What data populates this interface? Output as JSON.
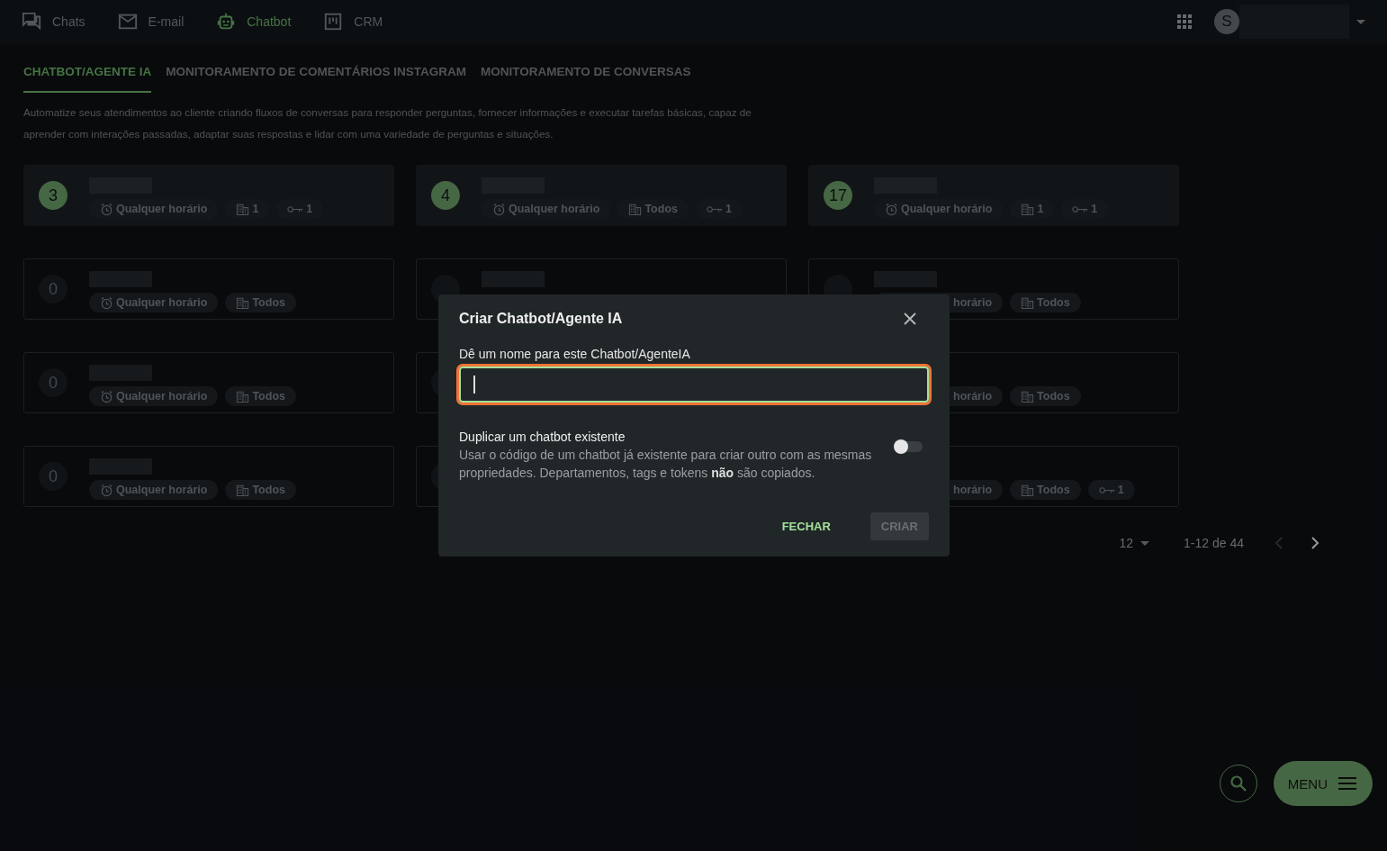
{
  "nav": {
    "items": [
      {
        "label": "Chats",
        "selected": false
      },
      {
        "label": "E-mail",
        "selected": false
      },
      {
        "label": "Chatbot",
        "selected": true
      },
      {
        "label": "CRM",
        "selected": false
      }
    ],
    "avatar": "S"
  },
  "tabs": [
    {
      "label": "CHATBOT/AGENTE IA",
      "selected": true
    },
    {
      "label": "MONITORAMENTO DE COMENTÁRIOS INSTAGRAM",
      "selected": false
    },
    {
      "label": "MONITORAMENTO DE CONVERSAS",
      "selected": false
    }
  ],
  "description": "Automatize seus atendimentos ao cliente criando fluxos de conversas para responder perguntas, fornecer informações e executar tarefas básicas, capaz de aprender com interações passadas, adaptar suas respostas e lidar com uma variedade de perguntas e situações.",
  "cards": [
    {
      "active": true,
      "count": "3",
      "chips": [
        {
          "kind": "time",
          "label": "Qualquer horário"
        },
        {
          "kind": "dept",
          "label": "1"
        },
        {
          "kind": "key",
          "label": "1"
        }
      ]
    },
    {
      "active": true,
      "count": "4",
      "chips": [
        {
          "kind": "time",
          "label": "Qualquer horário"
        },
        {
          "kind": "dept",
          "label": "Todos"
        },
        {
          "kind": "key",
          "label": "1"
        }
      ]
    },
    {
      "active": true,
      "count": "17",
      "chips": [
        {
          "kind": "time",
          "label": "Qualquer horário"
        },
        {
          "kind": "dept",
          "label": "1"
        },
        {
          "kind": "key",
          "label": "1"
        }
      ]
    },
    {
      "active": false,
      "count": "0",
      "chips": [
        {
          "kind": "time",
          "label": "Qualquer horário"
        },
        {
          "kind": "dept",
          "label": "Todos"
        }
      ]
    },
    {
      "active": false
    },
    {
      "active": false,
      "chips": [
        {
          "kind": "time-cut",
          "label": "horário"
        },
        {
          "kind": "dept",
          "label": "Todos"
        }
      ]
    },
    {
      "active": false,
      "count": "0",
      "chips": [
        {
          "kind": "time",
          "label": "Qualquer horário"
        },
        {
          "kind": "dept",
          "label": "Todos"
        }
      ]
    },
    {
      "active": false,
      "redacted_name": false
    },
    {
      "active": false,
      "redacted_name": false,
      "badge": false,
      "chips": [
        {
          "kind": "time-cut",
          "label": "horário"
        },
        {
          "kind": "dept",
          "label": "Todos"
        }
      ]
    },
    {
      "active": false,
      "count": "0",
      "chips": [
        {
          "kind": "time",
          "label": "Qualquer horário"
        },
        {
          "kind": "dept",
          "label": "Todos"
        }
      ]
    },
    {
      "active": false,
      "redacted_name": false
    },
    {
      "active": false,
      "redacted_name": false,
      "badge": false,
      "chips": [
        {
          "kind": "time-cut",
          "label": "horário"
        },
        {
          "kind": "dept",
          "label": "Todos"
        },
        {
          "kind": "key",
          "label": "1"
        }
      ]
    }
  ],
  "pagination": {
    "per_page": "12",
    "range": "1-12 de 44",
    "prev_disabled": true
  },
  "fab": {
    "menu": "MENU"
  },
  "dialog": {
    "title": "Criar Chatbot/Agente IA",
    "field": {
      "label": "Dê um nome para este Chatbot/AgenteIA",
      "focused": true
    },
    "duplicate": {
      "title": "Duplicar um chatbot existente",
      "description": "Usar o código de um chatbot já existente para criar outro com as mesmas propriedades. Departamentos, tags e tokens **não** são copiados.",
      "on": false
    },
    "buttons": [
      {
        "label": "FECHAR",
        "kind": "text",
        "disabled": false
      },
      {
        "label": "CRIAR",
        "kind": "filled",
        "disabled": true
      }
    ]
  }
}
